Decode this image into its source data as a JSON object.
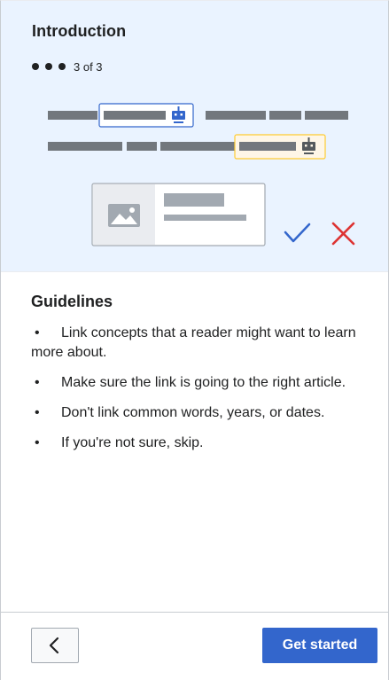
{
  "onboarding": {
    "title": "Introduction",
    "progress_text": "3 of 3",
    "progress_current": 3,
    "progress_total": 3
  },
  "illustration": {
    "link_box_color": "#3366cc",
    "suggestion_box_color": "#fc3",
    "text_line_color": "#72777d",
    "check_color": "#3366cc",
    "cross_color": "#d33"
  },
  "guidelines": {
    "heading": "Guidelines",
    "items": [
      {
        "bullet": "•",
        "text": "Link concepts that a reader might want to learn more about."
      },
      {
        "bullet": "•",
        "text": "Make sure the link is going to the right article."
      },
      {
        "bullet": "•",
        "text": "Don't link common words, years, or dates."
      },
      {
        "bullet": "•",
        "text": "If you're not sure, skip."
      }
    ]
  },
  "footer": {
    "back_icon": "chevron-left-icon",
    "primary_label": "Get started",
    "primary_color": "#3366cc"
  }
}
